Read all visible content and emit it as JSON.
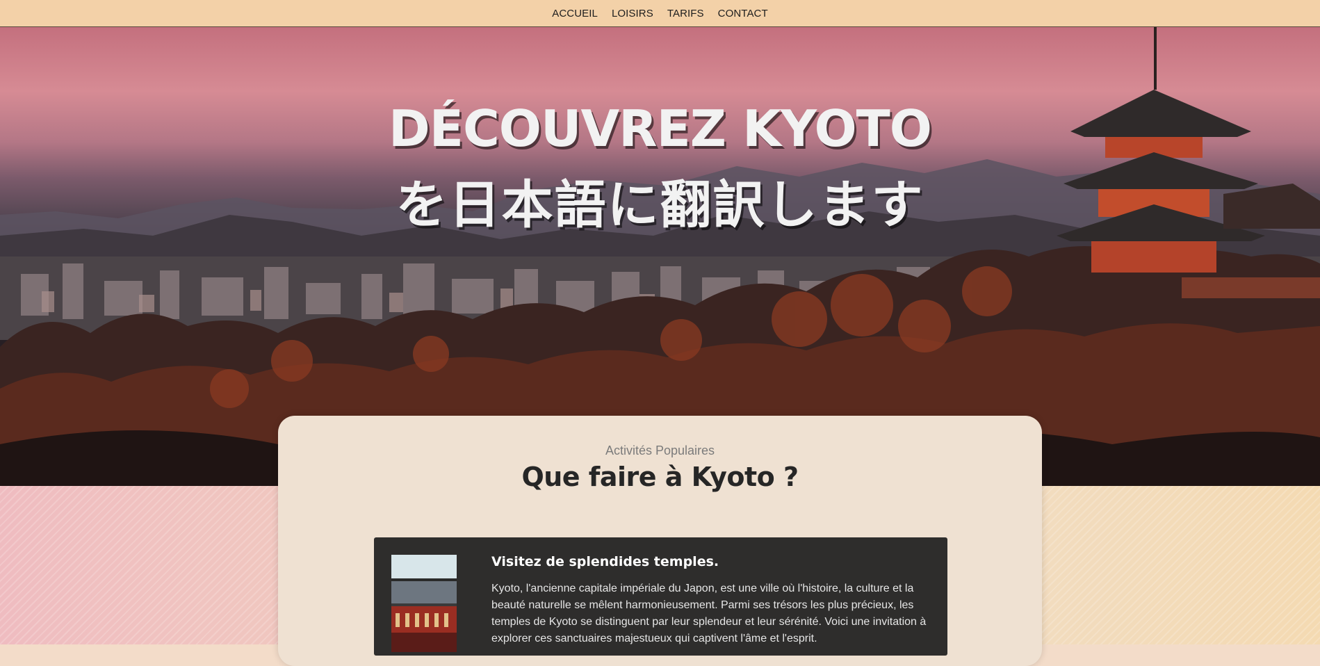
{
  "nav": {
    "items": [
      "ACCUEIL",
      "LOISIRS",
      "TARIFS",
      "CONTACT"
    ]
  },
  "hero": {
    "title_line1": "DÉCOUVREZ KYOTO",
    "title_line2": "を日本語に翻訳します"
  },
  "section": {
    "subtitle": "Activités Populaires",
    "title": "Que faire à Kyoto ?"
  },
  "activity": {
    "title": "Visitez de splendides temples.",
    "text": "Kyoto, l'ancienne capitale impériale du Japon, est une ville où l'histoire, la culture et la beauté naturelle se mêlent harmonieusement. Parmi ses trésors les plus précieux, les temples de Kyoto se distinguent par leur splendeur et leur sérénité. Voici une invitation à explorer ces sanctuaires majestueux qui captivent l'âme et l'esprit."
  },
  "colors": {
    "nav_bg": "#f3d1a8",
    "card_bg": "#efe1d2",
    "activity_bg": "#2e2d2c"
  }
}
